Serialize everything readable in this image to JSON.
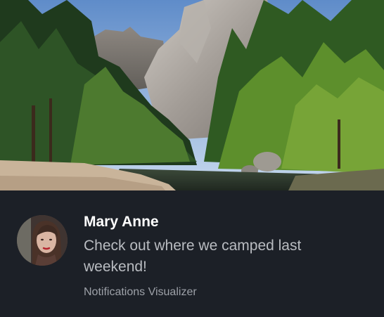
{
  "notification": {
    "hero_image": "yosemite-valley-landscape",
    "avatar_image": "woman-portrait",
    "title": "Mary Anne",
    "message": "Check out where we camped last weekend!",
    "attribution": "Notifications Visualizer"
  },
  "colors": {
    "background": "#1c2027",
    "title": "#ffffff",
    "message": "#b9bcc1",
    "attribution": "#9da1a8"
  }
}
